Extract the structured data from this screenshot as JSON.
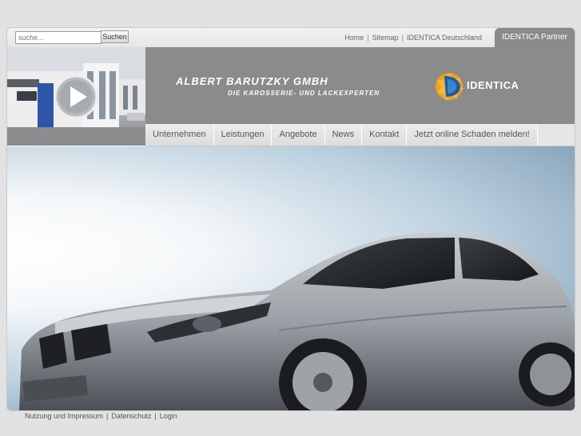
{
  "search": {
    "placeholder": "suche...",
    "button_label": "Suchen"
  },
  "top_links": [
    "Home",
    "Sitemap",
    "IDENTICA Deutschland"
  ],
  "partner_tab": "IDENTICA Partner",
  "header": {
    "company_name": "ALBERT BARUTZKY GMBH",
    "tagline": "DIE KAROSSERIE- UND LACKEXPERTEN",
    "logo_text": "IDENTICA",
    "play_icon": "play-icon"
  },
  "nav": [
    "Unternehmen",
    "Leistungen",
    "Angebote",
    "News",
    "Kontakt",
    "Jetzt online Schaden melden!"
  ],
  "footer_links": [
    "Nutzung und Impressum",
    "Datenschutz",
    "Login"
  ],
  "colors": {
    "banner": "#8b8b8b",
    "logo_orange": "#f0a020",
    "logo_blue": "#1e5aa0"
  }
}
